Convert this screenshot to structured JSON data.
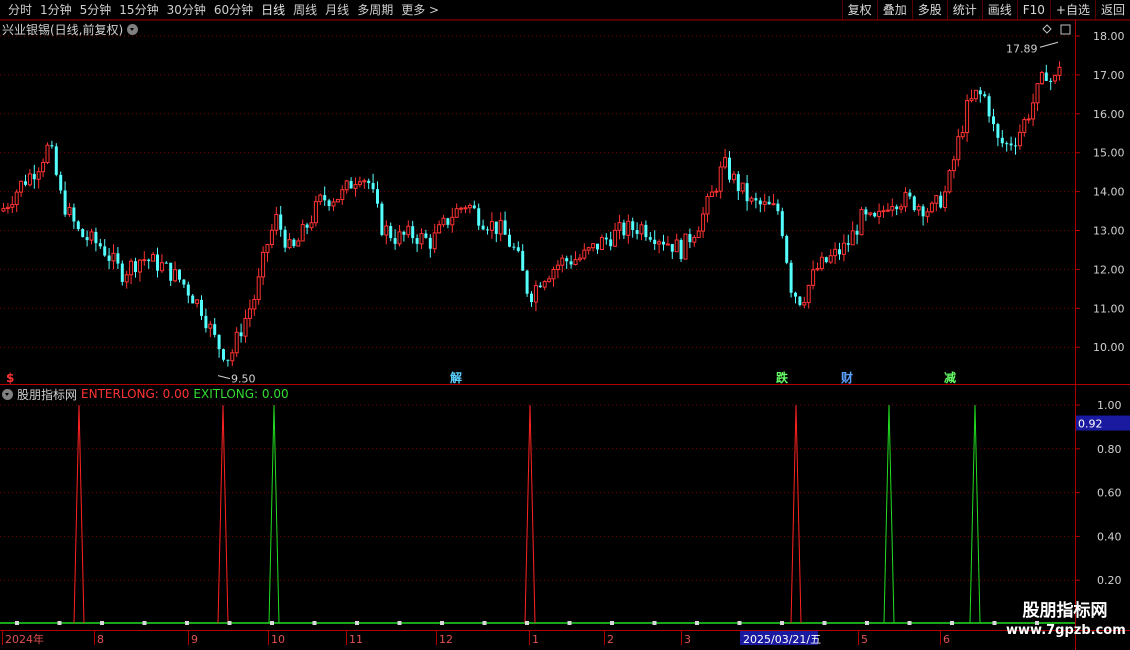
{
  "toolbar": {
    "periods": [
      "分时",
      "1分钟",
      "5分钟",
      "15分钟",
      "30分钟",
      "60分钟",
      "日线",
      "周线",
      "月线",
      "多周期",
      "更多 >"
    ],
    "active_period": "日线",
    "buttons": [
      "复权",
      "叠加",
      "多股",
      "统计",
      "画线",
      "F10",
      "+自选",
      "返回"
    ]
  },
  "main_panel": {
    "title": "兴业银锡(日线,前复权)",
    "price_axis": [
      "18.00",
      "17.00",
      "16.00",
      "15.00",
      "14.00",
      "13.00",
      "12.00",
      "11.00",
      "10.00"
    ],
    "high_label": "17.89",
    "low_label": "9.50",
    "event_markers": [
      {
        "text": "$",
        "color": "#ff3333"
      },
      {
        "text": "解",
        "color": "#5ad0ff"
      },
      {
        "text": "跌",
        "color": "#66ff66"
      },
      {
        "text": "财",
        "color": "#5aa0ff"
      },
      {
        "text": "减",
        "color": "#66ff66"
      }
    ]
  },
  "indicator_panel": {
    "name": "股朋指标网",
    "enter_label": "ENTERLONG: 0.00",
    "exit_label": "EXITLONG: 0.00",
    "axis": [
      "1.00",
      "0.80",
      "0.60",
      "0.40",
      "0.20"
    ],
    "current_value": "0.92",
    "enter_color": "#ff2222",
    "exit_color": "#22dd22"
  },
  "date_axis": {
    "labels": [
      "2024年",
      "8",
      "9",
      "10",
      "11",
      "12",
      "1",
      "2",
      "3",
      "2025/03/21/五",
      "5",
      "6"
    ]
  },
  "watermark": {
    "name": "股朋指标网",
    "url": "www.7gpzb.com"
  },
  "colors": {
    "up": "#ff3333",
    "down": "#54ffff",
    "grid": "#7a0000"
  }
}
